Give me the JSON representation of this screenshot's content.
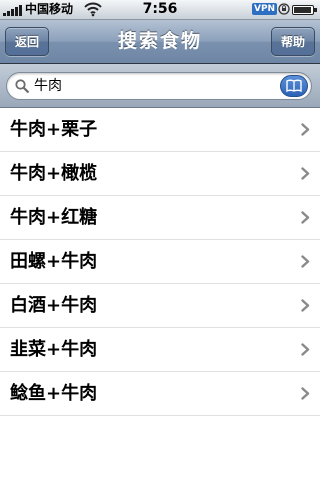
{
  "status_bar": {
    "carrier": "中国移动",
    "time": "7:56",
    "vpn": "VPN",
    "battery_level": 0.95
  },
  "nav": {
    "title": "搜索食物",
    "back_label": "返回",
    "help_label": "帮助"
  },
  "search": {
    "value": "牛肉",
    "icon": "search-icon",
    "bookmarks_icon": "book-icon"
  },
  "results": [
    {
      "label": "牛肉+栗子"
    },
    {
      "label": "牛肉+橄榄"
    },
    {
      "label": "牛肉+红糖"
    },
    {
      "label": "田螺+牛肉"
    },
    {
      "label": "白酒+牛肉"
    },
    {
      "label": "韭菜+牛肉"
    },
    {
      "label": "鲶鱼+牛肉"
    }
  ],
  "colors": {
    "nav_bar": "#7a91ae",
    "accent_button": "#2c63b6",
    "chevron": "#8a8a8a"
  }
}
